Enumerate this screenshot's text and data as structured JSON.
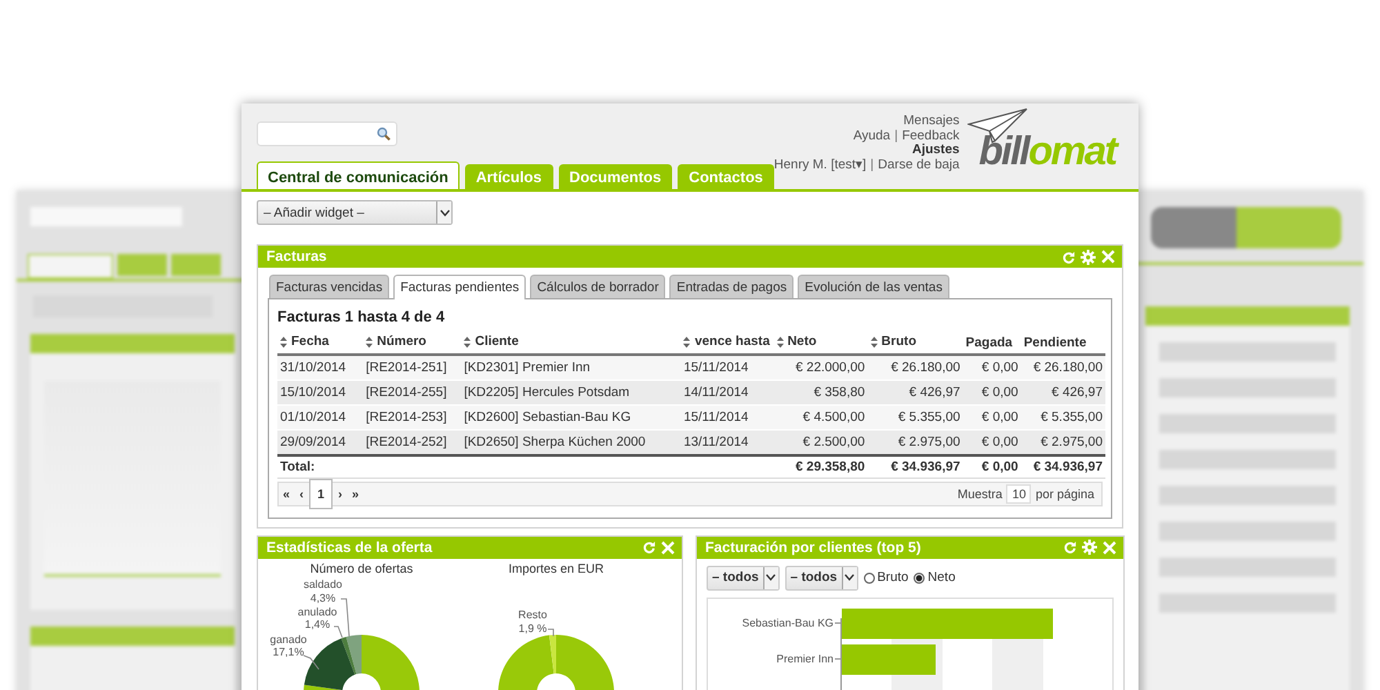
{
  "nav_tabs": [
    {
      "label": "Central de comunicación",
      "selected": true
    },
    {
      "label": "Artículos",
      "selected": false
    },
    {
      "label": "Documentos",
      "selected": false
    },
    {
      "label": "Contactos",
      "selected": false
    }
  ],
  "header_links": [
    [
      {
        "label": "Mensajes",
        "kind": "link"
      }
    ],
    [
      {
        "label": "Ayuda",
        "kind": "link"
      },
      {
        "label": "|",
        "kind": "separator"
      },
      {
        "label": "Feedback",
        "kind": "link"
      }
    ],
    [
      {
        "label": "Ajustes",
        "kind": "bold"
      }
    ],
    [
      {
        "label": "Henry M. [test▾]",
        "kind": "link"
      },
      {
        "label": "|",
        "kind": "separator"
      },
      {
        "label": "Darse de baja",
        "kind": "link"
      }
    ]
  ],
  "logo": {
    "first": "bill",
    "second": "omat"
  },
  "widget_select": {
    "value": "– Añadir widget –"
  },
  "invoices": {
    "title": "Facturas",
    "has_settings": true,
    "tabs": [
      {
        "label": "Facturas vencidas",
        "selected": false
      },
      {
        "label": "Facturas pendientes",
        "selected": true
      },
      {
        "label": "Cálculos de borrador",
        "selected": false
      },
      {
        "label": "Entradas de pagos",
        "selected": false
      },
      {
        "label": "Evolución de las ventas",
        "selected": false
      }
    ],
    "summary": "Facturas 1 hasta 4 de 4",
    "columns": [
      {
        "label": "Fecha",
        "sortable": true
      },
      {
        "label": "Número",
        "sortable": true
      },
      {
        "label": "Cliente",
        "sortable": true
      },
      {
        "label": "vence hasta",
        "sortable": true
      },
      {
        "label": "Neto",
        "sortable": true
      },
      {
        "label": "Bruto",
        "sortable": true
      },
      {
        "label": "Pagada",
        "sortable": false
      },
      {
        "label": "Pendiente",
        "sortable": false
      }
    ],
    "rows": [
      [
        "31/10/2014",
        "[RE2014-251]",
        "[KD2301] Premier Inn",
        "15/11/2014",
        "€ 22.000,00",
        "€ 26.180,00",
        "€ 0,00",
        "€ 26.180,00"
      ],
      [
        "15/10/2014",
        "[RE2014-255]",
        "[KD2205] Hercules Potsdam",
        "14/11/2014",
        "€ 358,80",
        "€ 426,97",
        "€ 0,00",
        "€ 426,97"
      ],
      [
        "01/10/2014",
        "[RE2014-253]",
        "[KD2600] Sebastian-Bau KG",
        "15/11/2014",
        "€ 4.500,00",
        "€ 5.355,00",
        "€ 0,00",
        "€ 5.355,00"
      ],
      [
        "29/09/2014",
        "[RE2014-252]",
        "[KD2650] Sherpa Küchen 2000",
        "13/11/2014",
        "€ 2.500,00",
        "€ 2.975,00",
        "€ 0,00",
        "€ 2.975,00"
      ]
    ],
    "total": {
      "label": "Total:",
      "values": [
        "€ 29.358,80",
        "€ 34.936,97",
        "€ 0,00",
        "€ 34.936,97"
      ]
    },
    "pagination": {
      "first": "«",
      "prev": "‹",
      "page": "1",
      "next": "›",
      "last": "»",
      "show": "Muestra",
      "per_page": "10",
      "per_page_suffix": "por página"
    }
  },
  "offer_stats": {
    "title": "Estadísticas de la oferta",
    "has_settings": false,
    "charts": [
      {
        "title": "Número de ofertas",
        "slices": [
          {
            "name": "saldado",
            "share": "4,3%"
          },
          {
            "name": "anulado",
            "share": "1,4%"
          },
          {
            "name": "ganado",
            "share": "17,1%"
          }
        ]
      },
      {
        "title": "Importes en EUR",
        "slices": [
          {
            "name": "Resto",
            "share": "1,9 %"
          }
        ]
      }
    ]
  },
  "revenue": {
    "title": "Facturación por clientes (top 5)",
    "has_settings": true,
    "filters": [
      "– todos",
      "– todos"
    ],
    "radios": [
      {
        "label": "Bruto",
        "selected": false
      },
      {
        "label": "Neto",
        "selected": true
      }
    ],
    "clients": [
      "Sebastian-Bau KG",
      "Premier Inn"
    ]
  }
}
